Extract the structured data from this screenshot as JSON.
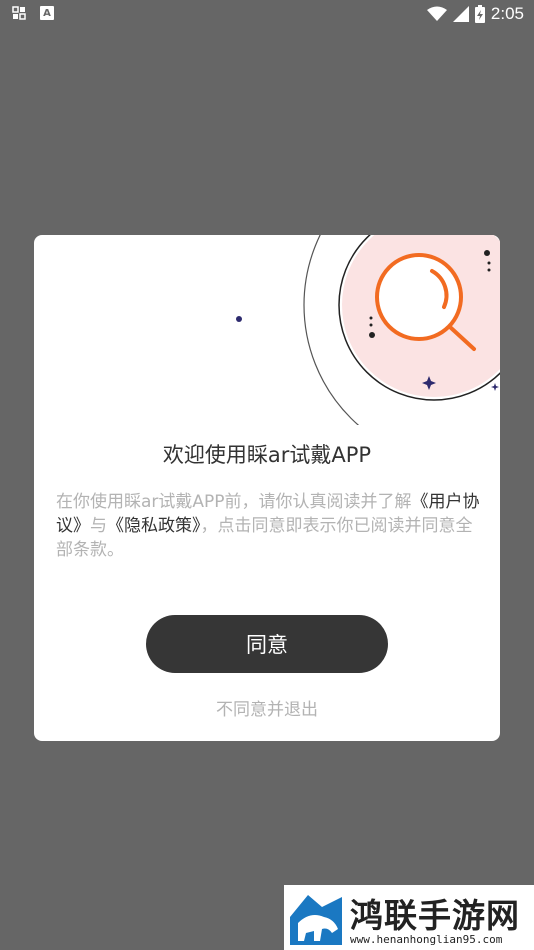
{
  "status_bar": {
    "time": "2:05",
    "left_icons": [
      "grid-notification-icon",
      "a-notification-icon"
    ],
    "right_icons": [
      "wifi-icon",
      "signal-icon",
      "battery-charging-icon"
    ],
    "a_icon_glyph": "A"
  },
  "dialog": {
    "title": "欢迎使用睬ar试戴APP",
    "body_pre": "在你使用睬ar试戴APP前，请你认真阅读并了解",
    "link_user_agreement": "《用户协议》",
    "body_mid": "与",
    "link_privacy_policy": "《隐私政策》",
    "body_post": "，点击同意即表示你已阅读并同意全部条款。",
    "agree_button": "同意",
    "decline_link": "不同意并退出"
  },
  "watermark": {
    "title": "鸿联手游网",
    "url": "www.henanhonglian95.com"
  },
  "colors": {
    "backdrop": "#666666",
    "dialog_bg": "#ffffff",
    "button_bg": "#363636",
    "accent_orange": "#f26b21",
    "circle_pink": "#fbe3e3",
    "muted_text": "#b3b3b3"
  }
}
